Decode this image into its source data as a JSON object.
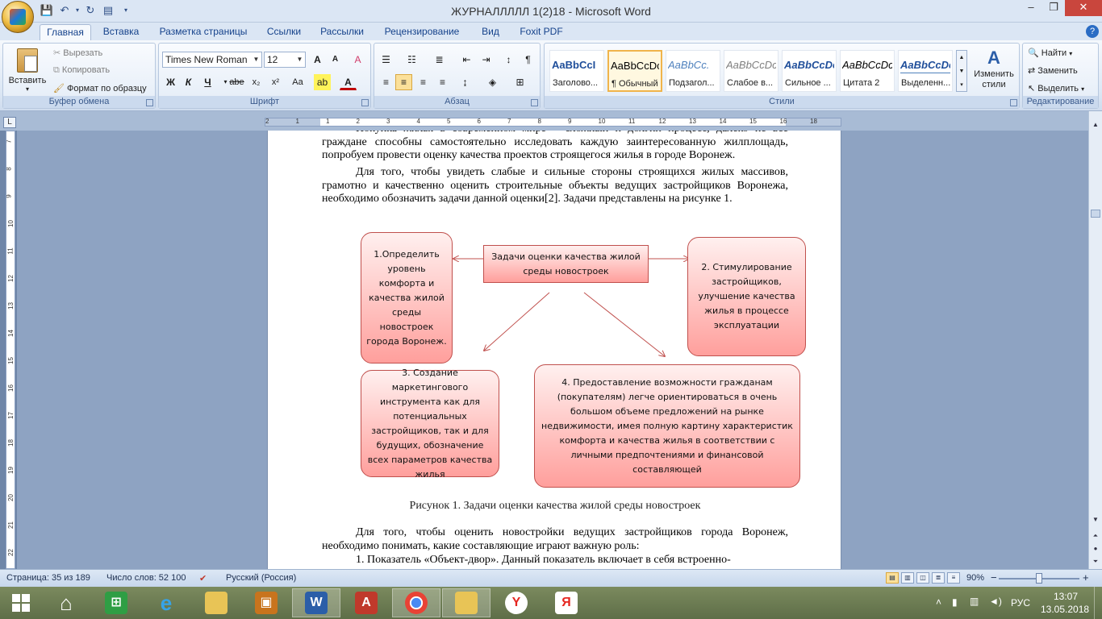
{
  "window": {
    "title": "ЖУРНАЛЛЛЛЛ 1(2)18 - Microsoft Word",
    "controls": [
      "–",
      "❐",
      "✕"
    ]
  },
  "tabs": [
    {
      "label": "Главная",
      "active": true
    },
    {
      "label": "Вставка"
    },
    {
      "label": "Разметка страницы"
    },
    {
      "label": "Ссылки"
    },
    {
      "label": "Рассылки"
    },
    {
      "label": "Рецензирование"
    },
    {
      "label": "Вид"
    },
    {
      "label": "Foxit PDF"
    }
  ],
  "ribbon": {
    "clipboard": {
      "paste": "Вставить",
      "cut": "Вырезать",
      "copy": "Копировать",
      "format_painter": "Формат по образцу",
      "label": "Буфер обмена"
    },
    "font": {
      "family": "Times New Roman",
      "size": "12",
      "label": "Шрифт",
      "buttons": {
        "bold": "Ж",
        "italic": "К",
        "underline": "Ч",
        "strike": "abe",
        "sub": "x₂",
        "sup": "x²",
        "case": "Aa",
        "grow": "A",
        "shrink": "A"
      }
    },
    "paragraph": {
      "label": "Абзац"
    },
    "styles": {
      "label": "Стили",
      "items": [
        {
          "sample": "AaBbCcI",
          "name": "Заголово...",
          "color": "#1f4e9a"
        },
        {
          "sample": "AaBbCcDc",
          "name": "¶ Обычный",
          "color": "#000000",
          "selected": true
        },
        {
          "sample": "AaBbCc.",
          "name": "Подзагол...",
          "color": "#4f81bd"
        },
        {
          "sample": "AaBbCcDc",
          "name": "Слабое в...",
          "color": "#7f7f7f"
        },
        {
          "sample": "AaBbCcDc",
          "name": "Сильное ...",
          "color": "#1f4e9a"
        },
        {
          "sample": "AaBbCcDc",
          "name": "Цитата 2",
          "color": "#000000"
        },
        {
          "sample": "AaBbCcDc",
          "name": "Выделенн...",
          "color": "#1f4e9a"
        }
      ],
      "change": "Изменить стили"
    },
    "editing": {
      "label": "Редактирование",
      "find": "Найти",
      "replace": "Заменить",
      "select": "Выделить"
    }
  },
  "ruler": {
    "numbers": [
      "2",
      "1",
      "1",
      "2",
      "3",
      "4",
      "5",
      "6",
      "7",
      "8",
      "9",
      "10",
      "11",
      "12",
      "13",
      "14",
      "15",
      "16",
      "18"
    ],
    "vertical": [
      "7",
      "8",
      "9",
      "10",
      "11",
      "12",
      "13",
      "14",
      "15",
      "16",
      "17",
      "18",
      "19",
      "20",
      "21",
      "22"
    ]
  },
  "document": {
    "para1": "Покупка жилья в современном мире – сложный и долгий процесс, далеко не все граждане способны самостоятельно исследовать каждую заинтересованную жилплощадь, попробуем провести оценку качества проектов строящегося жилья в городе Воронеж.",
    "para2": "Для того, чтобы  увидеть слабые и сильные стороны строящихся жилых массивов, грамотно и качественно оценить строительные объекты ведущих застройщиков Воронежа, необходимо обозначить задачи данной оценки[2]. Задачи представлены на рисунке 1.",
    "diagram": {
      "center": "Задачи оценки качества жилой среды новостроек",
      "box1": "1.Определить уровень комфорта и качества жилой среды новостроек города Воронеж.",
      "box2": "2. Стимулирование застройщиков, улучшение качества жилья в процессе эксплуатации",
      "box3": "3.  Создание маркетингового инструмента как для потенциальных застройщиков, так и для будущих, обозначение всех параметров качества жилья",
      "box4": "4. Предоставление возможности гражданам (покупателям) легче ориентироваться в очень большом объеме  предложений на рынке недвижимости, имея полную картину характеристик комфорта и качества жилья в соответствии с личными предпочтениями и финансовой составляющей"
    },
    "caption": "Рисунок 1. Задачи оценки качества жилой среды новостроек",
    "para3": "Для того, чтобы оценить новостройки ведущих застройщиков города Воронеж, необходимо понимать, какие составляющие играют важную роль:",
    "para4": "1.   Показатель «Объект-двор». Данный показатель включает в себя встроенно-"
  },
  "status": {
    "page": "Страница: 35 из 189",
    "words": "Число слов: 52 100",
    "language": "Русский (Россия)",
    "zoom": "90%",
    "zoom_minus": "−",
    "zoom_plus": "+"
  },
  "taskbar": {
    "lang": "РУС",
    "time": "13:07",
    "date": "13.05.2018"
  }
}
